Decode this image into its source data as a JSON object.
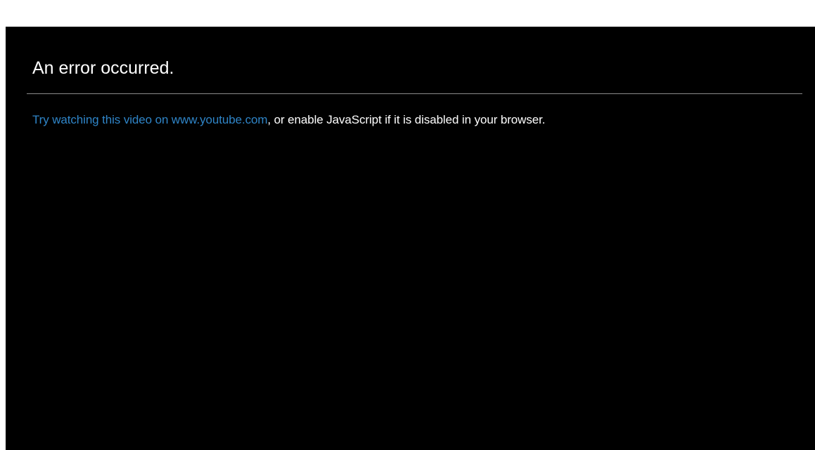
{
  "player": {
    "error_title": "An error occurred.",
    "message": {
      "link_text": "Try watching this video on www.youtube.com",
      "rest_text": ", or enable JavaScript if it is disabled in your browser."
    }
  },
  "colors": {
    "background": "#000000",
    "text": "#ffffff",
    "link": "#2f85c8",
    "divider": "#8a8a8a"
  }
}
